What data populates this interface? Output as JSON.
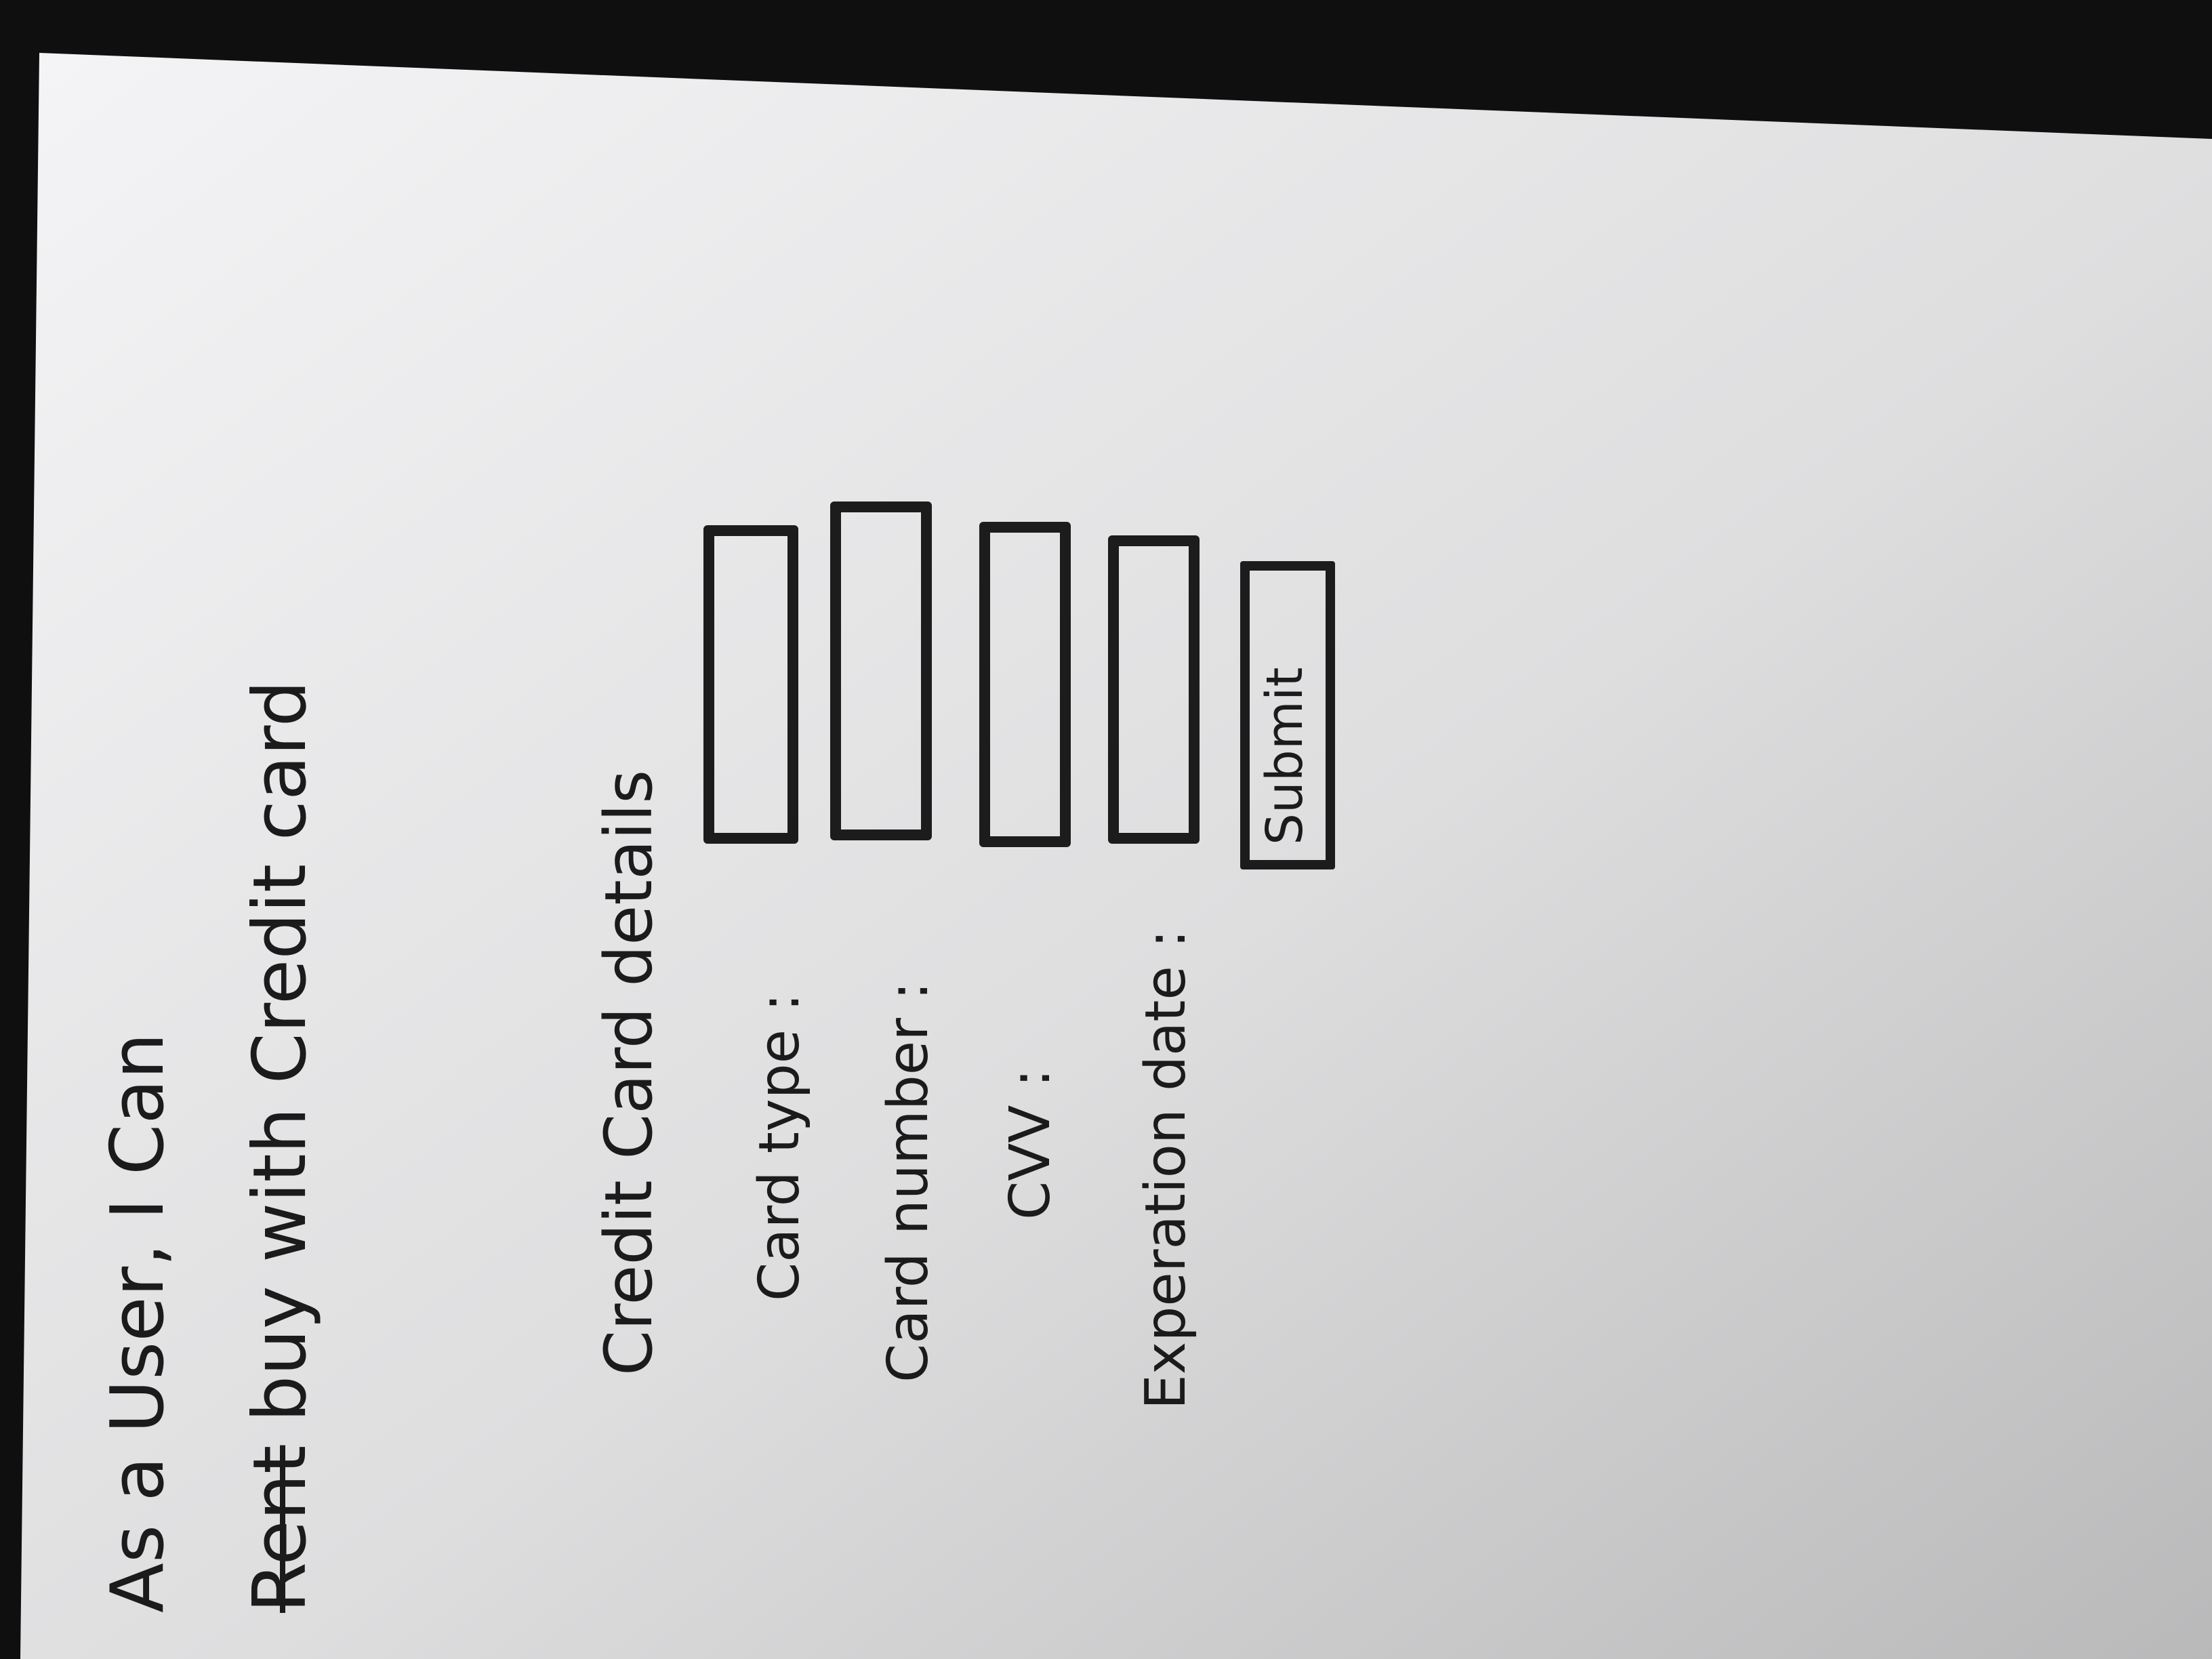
{
  "story": {
    "line1": "As a User, I Can",
    "line2_scribbled": "Rent",
    "line2": "buy with Credit card"
  },
  "form": {
    "title": "Credit Card details",
    "fields": [
      {
        "label": "Card type :",
        "value": ""
      },
      {
        "label": "Card number :",
        "value": ""
      },
      {
        "label": "CVV :",
        "value": ""
      },
      {
        "label": "Experation date :",
        "value": ""
      }
    ],
    "submit_label": "Submit"
  }
}
